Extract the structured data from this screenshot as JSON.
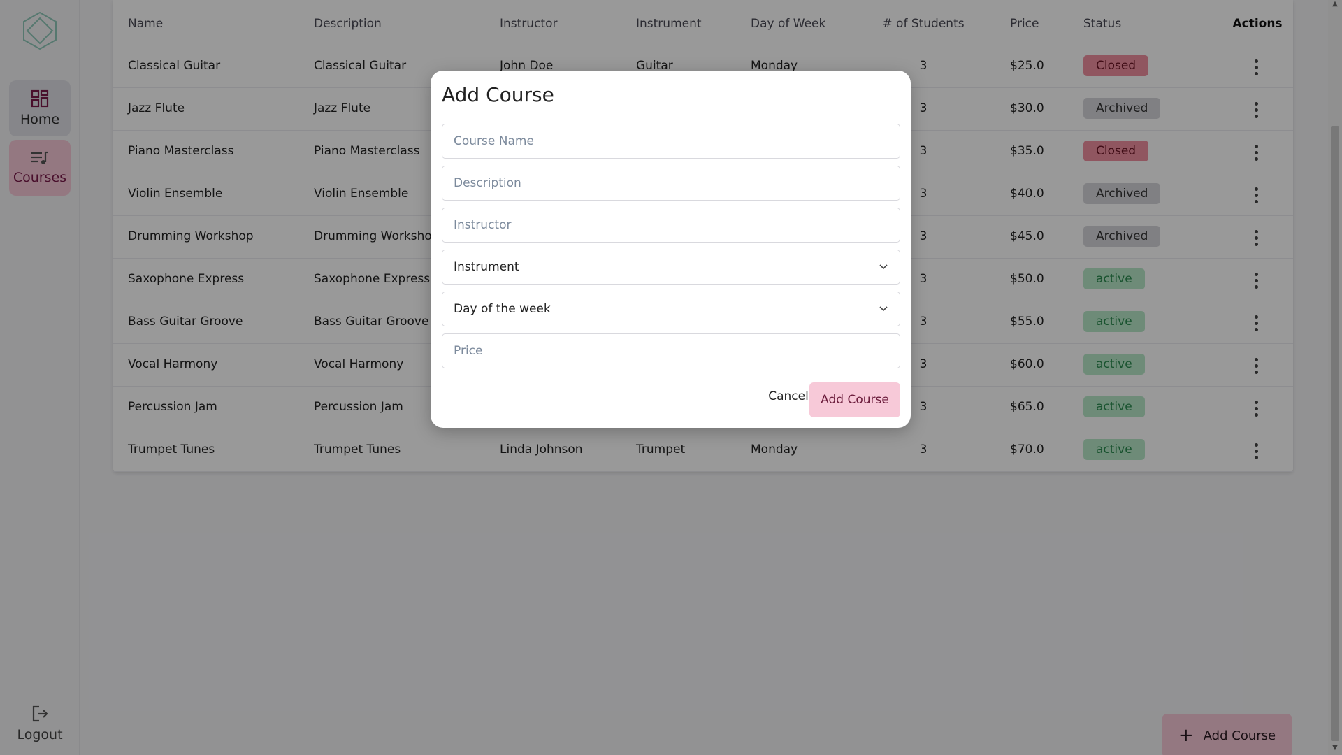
{
  "sidebar": {
    "logo_icon": "hexagon-logo-icon",
    "items": [
      {
        "label": "Home",
        "icon": "grid-icon"
      },
      {
        "label": "Courses",
        "icon": "playlist-icon"
      }
    ],
    "logout": {
      "label": "Logout",
      "icon": "logout-icon"
    }
  },
  "table": {
    "headers": [
      "Name",
      "Description",
      "Instructor",
      "Instrument",
      "Day of Week",
      "# of Students",
      "Price",
      "Status",
      "Actions"
    ],
    "rows": [
      {
        "name": "Classical Guitar",
        "description": "Classical Guitar",
        "instructor": "John Doe",
        "instrument": "Guitar",
        "day": "Monday",
        "students": "3",
        "price": "$25.0",
        "status": "Closed",
        "status_kind": "closed"
      },
      {
        "name": "Jazz Flute",
        "description": "Jazz Flute",
        "instructor": "",
        "instrument": "",
        "day": "",
        "students": "3",
        "price": "$30.0",
        "status": "Archived",
        "status_kind": "archived"
      },
      {
        "name": "Piano Masterclass",
        "description": "Piano Masterclass",
        "instructor": "",
        "instrument": "",
        "day": "",
        "students": "3",
        "price": "$35.0",
        "status": "Closed",
        "status_kind": "closed"
      },
      {
        "name": "Violin Ensemble",
        "description": "Violin Ensemble",
        "instructor": "",
        "instrument": "",
        "day": "",
        "students": "3",
        "price": "$40.0",
        "status": "Archived",
        "status_kind": "archived"
      },
      {
        "name": "Drumming Workshop",
        "description": "Drumming Workshop",
        "instructor": "",
        "instrument": "",
        "day": "",
        "students": "3",
        "price": "$45.0",
        "status": "Archived",
        "status_kind": "archived"
      },
      {
        "name": "Saxophone Express",
        "description": "Saxophone Express",
        "instructor": "",
        "instrument": "",
        "day": "",
        "students": "3",
        "price": "$50.0",
        "status": "active",
        "status_kind": "active"
      },
      {
        "name": "Bass Guitar Groove",
        "description": "Bass Guitar Groove",
        "instructor": "",
        "instrument": "",
        "day": "",
        "students": "3",
        "price": "$55.0",
        "status": "active",
        "status_kind": "active"
      },
      {
        "name": "Vocal Harmony",
        "description": "Vocal Harmony",
        "instructor": "",
        "instrument": "",
        "day": "",
        "students": "3",
        "price": "$60.0",
        "status": "active",
        "status_kind": "active"
      },
      {
        "name": "Percussion Jam",
        "description": "Percussion Jam",
        "instructor": "",
        "instrument": "",
        "day": "",
        "students": "3",
        "price": "$65.0",
        "status": "active",
        "status_kind": "active"
      },
      {
        "name": "Trumpet Tunes",
        "description": "Trumpet Tunes",
        "instructor": "Linda Johnson",
        "instrument": "Trumpet",
        "day": "Monday",
        "students": "3",
        "price": "$70.0",
        "status": "active",
        "status_kind": "active"
      }
    ]
  },
  "fab": {
    "label": "Add Course",
    "icon": "plus-icon"
  },
  "modal": {
    "title": "Add Course",
    "course_name_placeholder": "Course Name",
    "description_placeholder": "Description",
    "instructor_placeholder": "Instructor",
    "instrument_value": "Instrument",
    "day_value": "Day of the week",
    "price_placeholder": "Price",
    "cancel_label": "Cancel",
    "submit_label": "Add Course"
  },
  "colors": {
    "accent_pink": "#f7c9d8",
    "closed": "#f08fa0",
    "archived": "#d5d5da",
    "active": "#b8e8c8"
  }
}
